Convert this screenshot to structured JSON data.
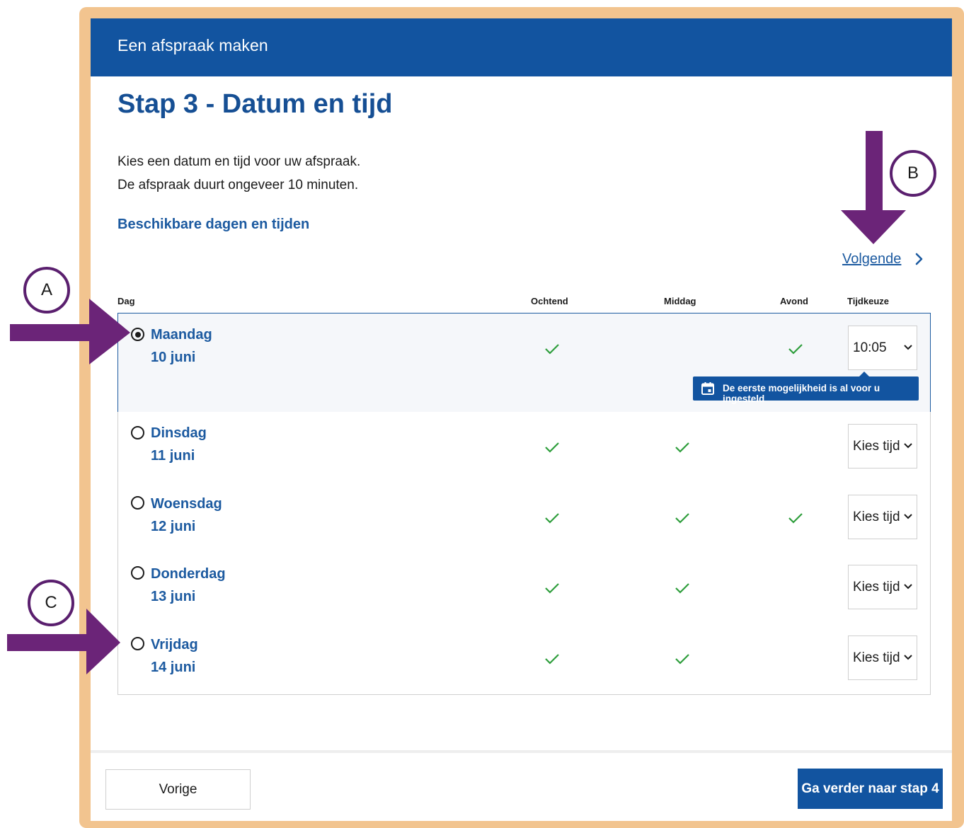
{
  "header": {
    "title": "Een afspraak maken"
  },
  "page": {
    "title": "Stap 3 - Datum en tijd",
    "intro_line1": "Kies een datum en tijd voor uw afspraak.",
    "intro_line2": "De afspraak duurt ongeveer 10 minuten.",
    "section_link": "Beschikbare dagen en tijden",
    "next_link": "Volgende"
  },
  "table": {
    "headers": {
      "day": "Dag",
      "morning": "Ochtend",
      "afternoon": "Middag",
      "evening": "Avond",
      "time": "Tijdkeuze"
    },
    "rows": [
      {
        "day": "Maandag",
        "date": "10 juni",
        "morning": true,
        "afternoon": false,
        "evening": true,
        "time": "10:05",
        "selected": true
      },
      {
        "day": "Dinsdag",
        "date": "11 juni",
        "morning": true,
        "afternoon": true,
        "evening": false,
        "time": "Kies tijd",
        "selected": false
      },
      {
        "day": "Woensdag",
        "date": "12 juni",
        "morning": true,
        "afternoon": true,
        "evening": true,
        "time": "Kies tijd",
        "selected": false
      },
      {
        "day": "Donderdag",
        "date": "13 juni",
        "morning": true,
        "afternoon": true,
        "evening": false,
        "time": "Kies tijd",
        "selected": false
      },
      {
        "day": "Vrijdag",
        "date": "14 juni",
        "morning": true,
        "afternoon": true,
        "evening": false,
        "time": "Kies tijd",
        "selected": false
      }
    ]
  },
  "tooltip": {
    "text": "De eerste mogelijkheid is al voor u ingesteld",
    "icon": "calendar-icon"
  },
  "footer": {
    "prev_label": "Vorige",
    "next_label": "Ga verder naar stap 4"
  },
  "annotations": {
    "a": "A",
    "b": "B",
    "c": "C"
  },
  "colors": {
    "brand_blue": "#1254a0",
    "link_blue": "#1c5aa0",
    "check_green": "#2e9e3c",
    "annotation_purple": "#6b2478",
    "frame_orange": "#f2c48f"
  }
}
